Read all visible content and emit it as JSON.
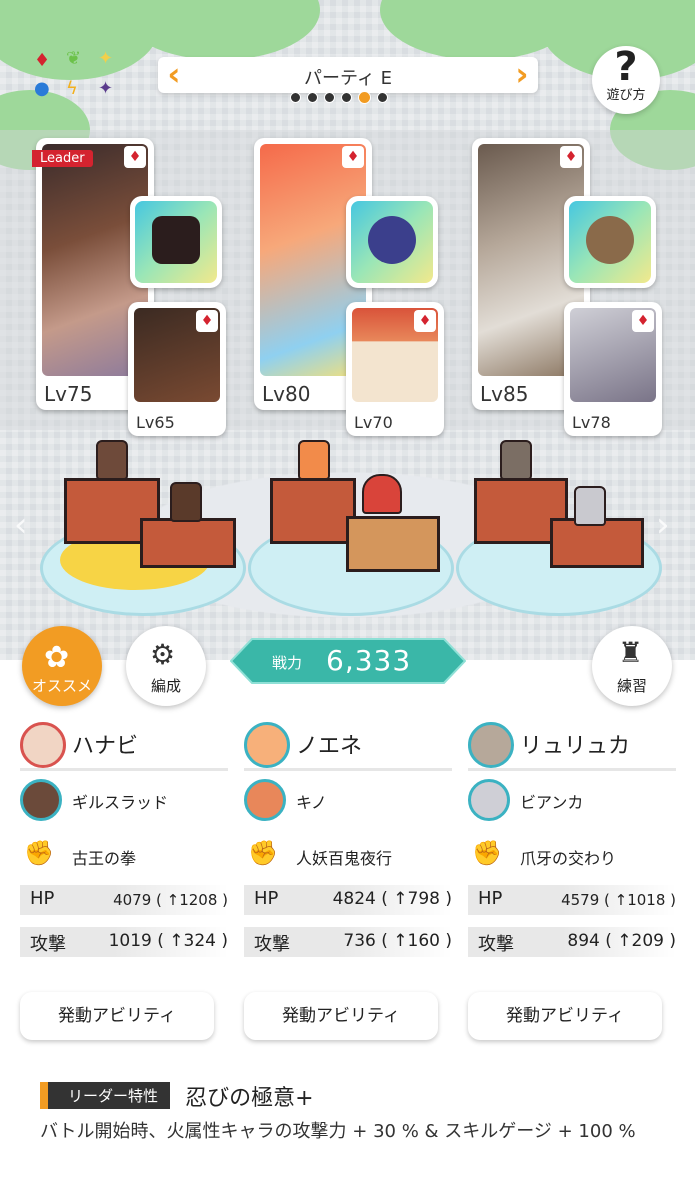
{
  "party": {
    "title": "パーティ E",
    "page_count": 6,
    "active_page": 5
  },
  "help": {
    "icon": "question-mark-icon",
    "label": "遊び方"
  },
  "element_icons": [
    "diamond-red",
    "leaf-green",
    "sparkle-yellow",
    "circle-blue",
    "bolt-yellow",
    "star-purple"
  ],
  "colors": {
    "accent": "#f29c23",
    "element_red": "#d4232f",
    "power_teal": "#3ab7a8"
  },
  "slots": [
    {
      "leader_tag": "Leader",
      "main_lv": "Lv75",
      "sub_lv": "Lv65"
    },
    {
      "main_lv": "Lv80",
      "sub_lv": "Lv70"
    },
    {
      "main_lv": "Lv85",
      "sub_lv": "Lv78"
    }
  ],
  "buttons": {
    "recommend": "オススメ",
    "formation": "編成",
    "practice": "練習"
  },
  "power": {
    "label": "戦力",
    "value": "6,333"
  },
  "members": [
    {
      "name": "ハナビ",
      "sub": "ギルスラッド",
      "skill": "古王の拳",
      "hp_label": "HP",
      "hp": "4079 ( ↑1208 )",
      "atk_label": "攻撃",
      "atk": "1019 ( ↑324 )",
      "ability": "発動アビリティ"
    },
    {
      "name": "ノエネ",
      "sub": "キノ",
      "skill": "人妖百鬼夜行",
      "hp_label": "HP",
      "hp": "4824 ( ↑798 )",
      "atk_label": "攻撃",
      "atk": "736 ( ↑160 )",
      "ability": "発動アビリティ"
    },
    {
      "name": "リュリュカ",
      "sub": "ビアンカ",
      "skill": "爪牙の交わり",
      "hp_label": "HP",
      "hp": "4579 ( ↑1018 )",
      "atk_label": "攻撃",
      "atk": "894 ( ↑209 )",
      "ability": "発動アビリティ"
    }
  ],
  "leader_trait": {
    "tag": "リーダー特性",
    "name": "忍びの極意+",
    "desc": "バトル開始時、火属性キャラの攻撃力 + 30 % & スキルゲージ + 100 %"
  }
}
